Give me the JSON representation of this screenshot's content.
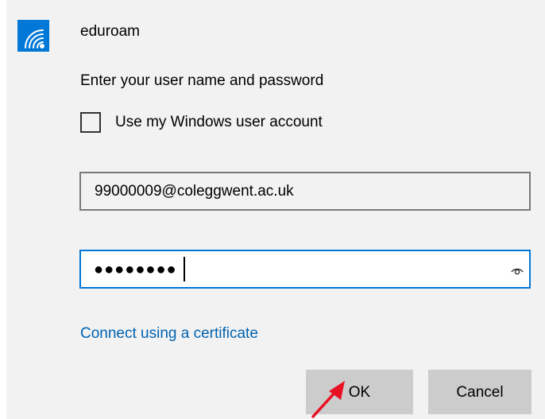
{
  "network": {
    "name": "eduroam",
    "icon": "wifi-icon",
    "accent_color": "#0078d7"
  },
  "prompt": "Enter your user name and password",
  "windows_account": {
    "label": "Use my Windows user account",
    "checked": false
  },
  "username": {
    "value": "99000009@coleggwent.ac.uk"
  },
  "password": {
    "masked_value": "●●●●●●●●",
    "reveal_icon": "eye-icon"
  },
  "certificate_link": "Connect using a certificate",
  "buttons": {
    "ok": "OK",
    "cancel": "Cancel"
  },
  "annotation": {
    "icon": "red-arrow",
    "color": "#e81123"
  }
}
